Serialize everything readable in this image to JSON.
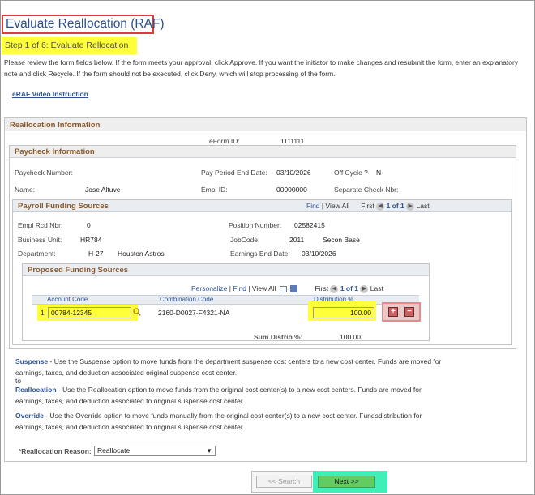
{
  "page": {
    "title": "Evaluate Reallocation (RAF)",
    "step": "Step 1 of 6: Evaluate Rellocation",
    "instructions": "Please review the form fields below. If the form meets your approval, click Approve. If you want the initiator to make changes and resubmit the form, enter an explanatory note and click Recycle. If the form should not be executed, click Deny, which will stop processing of the form.",
    "video_link": "eRAF Video Instruction"
  },
  "reallocation": {
    "header": "Reallocation Information",
    "eform_label": "eForm ID:",
    "eform_value": "1111111"
  },
  "paycheck": {
    "header": "Paycheck Information",
    "number_label": "Paycheck Number:",
    "pay_period_label": "Pay Period End Date:",
    "pay_period_value": "03/10/2026",
    "off_cycle_label": "Off Cycle ?",
    "off_cycle_value": "N",
    "name_label": "Name:",
    "name_value": "Jose Altuve",
    "empl_id_label": "Empl ID:",
    "empl_id_value": "00000000",
    "sep_check_label": "Separate Check Nbr:"
  },
  "payroll": {
    "header": "Payroll Funding Sources",
    "nav": {
      "find": "Find",
      "sep": "|",
      "view_all": "View All",
      "first": "First",
      "range": "1 of 1",
      "last": "Last"
    },
    "empl_rcd_label": "Empl Rcd Nbr:",
    "empl_rcd_value": "0",
    "position_label": "Position Number:",
    "position_value": "02582415",
    "bu_label": "Business Unit:",
    "bu_value": "HR784",
    "jobcode_label": "JobCode:",
    "jobcode_value": "2011",
    "jobcode_desc": "Secon Base",
    "dept_label": "Department:",
    "dept_value": "H-27",
    "dept_desc": "Houston Astros",
    "earn_end_label": "Earnings End Date:",
    "earn_end_value": "03/10/2026"
  },
  "proposed": {
    "header": "Proposed Funding Sources",
    "nav": {
      "personalize": "Personalize",
      "sep": "|",
      "find": "Find",
      "view_all": "View All",
      "first": "First",
      "range": "1 of 1",
      "last": "Last"
    },
    "columns": {
      "account": "Account Code",
      "combination": "Combination Code",
      "distribution": "Distribution %"
    },
    "row": {
      "num": "1",
      "account": "00784-12345",
      "combination": "2160-D0027-F4321-NA",
      "distribution": "100.00"
    },
    "sum_label": "Sum Distrib %:",
    "sum_value": "100.00"
  },
  "help": [
    {
      "term": "Suspense",
      "text": " - Use the Suspense option to move funds from the       department suspense cost centers to a new cost center. Funds  are moved for earnings, taxes, and deduction associated      original suspense cost center.",
      "extra": "to"
    },
    {
      "term": "Reallocation",
      "text": " - Use the Reallocation option to move funds from the          original cost center(s) to a new cost centers. Funds are moved for earnings, taxes, and deduction associated to      original suspense cost center."
    },
    {
      "term": "Override",
      "text": " - Use the Override option to move funds manually from the       original cost center(s) to a new cost center. Fundsdistribution for earnings, taxes, and deduction associated to      original suspense cost center."
    }
  ],
  "reason": {
    "label": "*Reallocation Reason:",
    "selected": "Reallocate"
  },
  "buttons": {
    "prev": "<< Search",
    "next": "Next >>"
  },
  "icons": {
    "lookup": "magnifier-icon",
    "add": "plus-icon",
    "remove": "minus-icon",
    "grid": "grid-icon",
    "download": "download-icon"
  },
  "colors": {
    "highlight": "#ffff3a",
    "red_outline": "#e03a3e",
    "next_highlight": "#3ef0b7",
    "header_text": "#8b5a2b",
    "link": "#2d5396"
  }
}
